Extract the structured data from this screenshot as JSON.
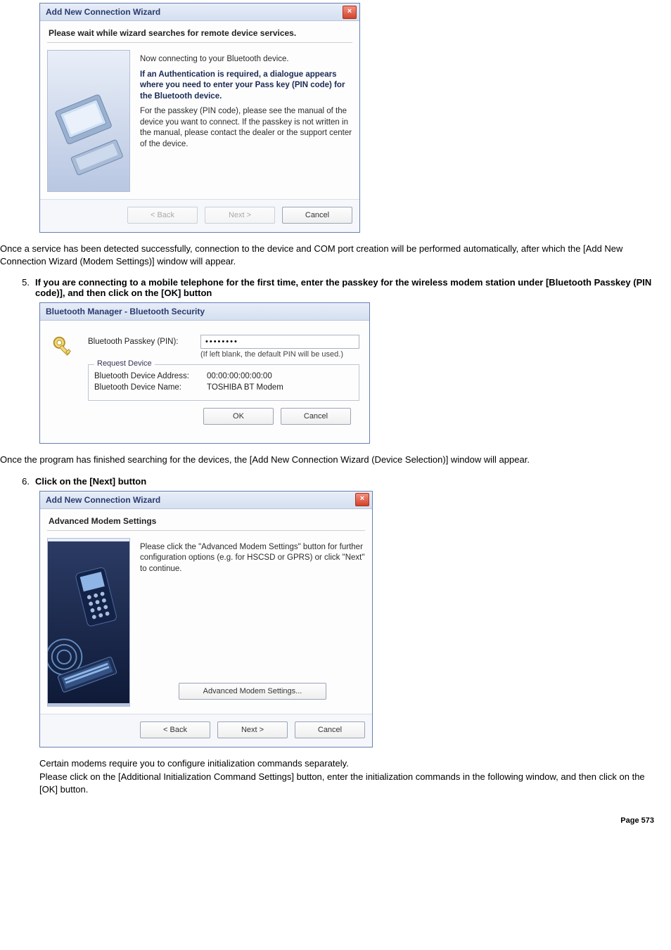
{
  "wizard1": {
    "title": "Add New Connection Wizard",
    "header": "Please wait while wizard searches for remote device services.",
    "line1": "Now connecting to your Bluetooth device.",
    "bold": "If an Authentication is required, a dialogue appears where you need to enter your Pass key (PIN code) for the Bluetooth device.",
    "line2": "For the passkey (PIN code), please see the manual of the device you want to connect. If the passkey is not written in the manual, please contact the dealer or the support center of the device.",
    "back": "< Back",
    "next": "Next >",
    "cancel": "Cancel"
  },
  "para1": "Once a service has been detected successfully, connection to the device and COM port creation will be performed automatically, after which the [Add New Connection Wizard (Modem Settings)] window will appear.",
  "step5": {
    "no": "5.",
    "text": "If you are connecting to a mobile telephone for the first time, enter the passkey for the wireless modem station under [Bluetooth Passkey (PIN code)], and then click on the [OK] button"
  },
  "security": {
    "title": "Bluetooth Manager - Bluetooth Security",
    "passkey_lbl": "Bluetooth Passkey (PIN):",
    "passkey_val": "••••••••",
    "hint": "(If left blank, the default PIN will be used.)",
    "legend": "Request Device",
    "addr_lbl": "Bluetooth Device Address:",
    "addr_val": "00:00:00:00:00:00",
    "name_lbl": "Bluetooth Device Name:",
    "name_val": "TOSHIBA BT Modem",
    "ok": "OK",
    "cancel": "Cancel"
  },
  "para2": "Once the program has finished searching for the devices, the [Add New Connection Wizard (Device Selection)] window will appear.",
  "step6": {
    "no": "6.",
    "text": "Click on the [Next] button"
  },
  "wizard2": {
    "title": "Add New Connection Wizard",
    "header": "Advanced Modem Settings",
    "line1": "Please click the \"Advanced Modem Settings\" button for further configuration options (e.g. for HSCSD or GPRS) or click \"Next\" to continue.",
    "adv": "Advanced Modem Settings...",
    "back": "< Back",
    "next": "Next >",
    "cancel": "Cancel"
  },
  "para3a": "Certain modems require you to configure initialization commands separately.",
  "para3b": "Please click on the [Additional Initialization Command Settings] button, enter the initialization commands in the following window, and then click on the [OK] button.",
  "footer": "Page 573",
  "chart_data": null
}
